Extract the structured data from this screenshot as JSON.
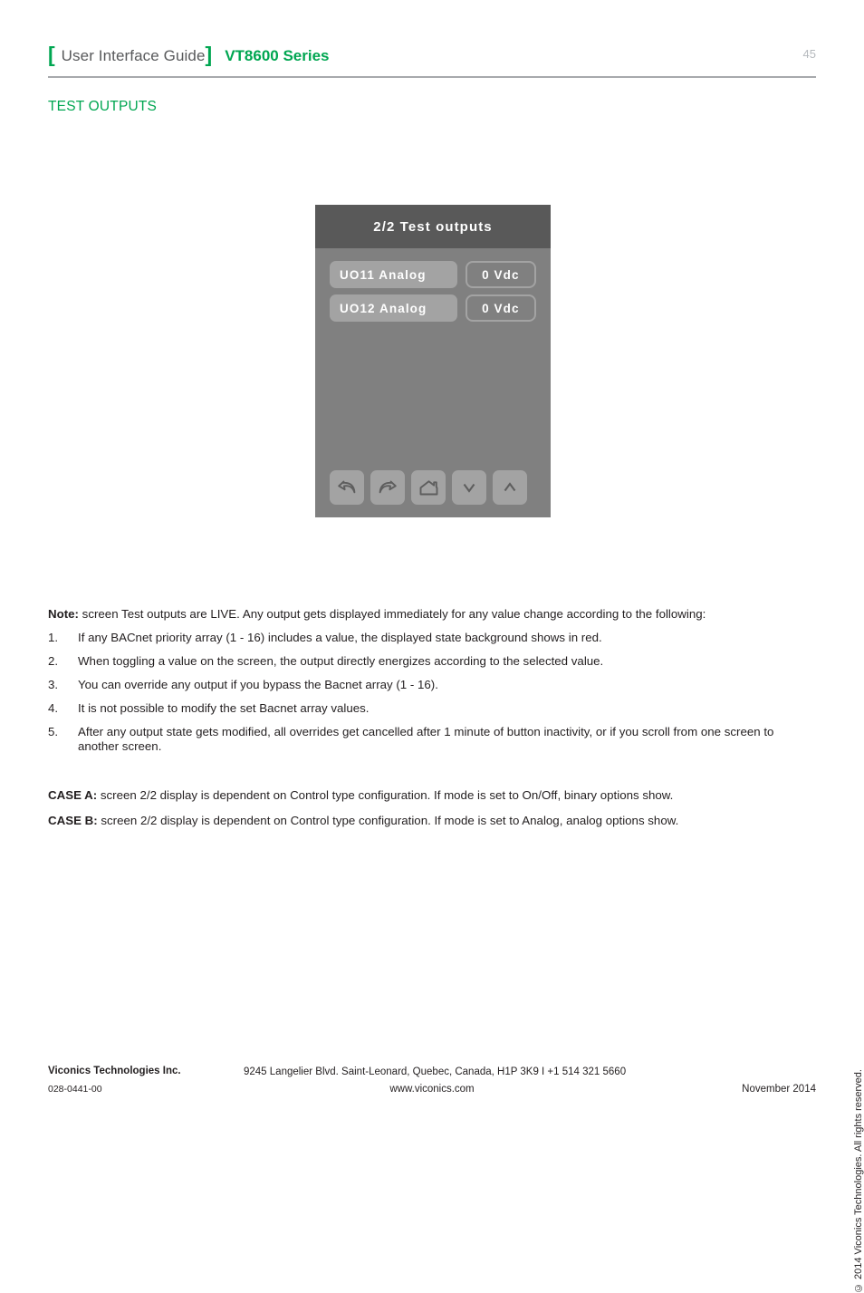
{
  "header": {
    "bracket_left": "[",
    "bracket_right": "]",
    "guide_label": "User Interface Guide",
    "series_label": "VT8600 Series",
    "page_number": "45"
  },
  "section": {
    "title": "TEST OUTPUTS"
  },
  "device": {
    "screen_title": "2/2 Test outputs",
    "rows": [
      {
        "label": "UO11 Analog",
        "value": "0 Vdc"
      },
      {
        "label": "UO12 Analog",
        "value": "0 Vdc"
      }
    ],
    "nav": [
      {
        "name": "undo",
        "glyph": "undo-arrow-icon"
      },
      {
        "name": "redo",
        "glyph": "redo-arrow-icon"
      },
      {
        "name": "home",
        "glyph": "home-icon"
      },
      {
        "name": "down",
        "glyph": "chevron-down-icon"
      },
      {
        "name": "up",
        "glyph": "chevron-up-icon"
      }
    ],
    "colors": {
      "header_bg": "#595959",
      "body_bg": "#808080",
      "pill_bg": "#a3a3a3",
      "text": "#ffffff"
    }
  },
  "notes": {
    "lead_bold": "Note:",
    "lead_text": " screen Test outputs are LIVE. Any output gets displayed immediately for any value change according to the following:",
    "items": [
      {
        "num": "1.",
        "text": "If any BACnet priority array (1 - 16) includes a value, the displayed state background shows in red."
      },
      {
        "num": "2.",
        "text": "When toggling a value on the screen, the output directly energizes according to the selected value."
      },
      {
        "num": "3.",
        "text": "You can override any output if you bypass the Bacnet array (1 - 16)."
      },
      {
        "num": "4.",
        "text": "It is not possible to modify the set Bacnet array values."
      },
      {
        "num": "5.",
        "text": "After any output state gets modified, all overrides get cancelled after 1 minute of button inactivity, or if you scroll from one screen to another screen."
      }
    ]
  },
  "cases": [
    {
      "label": "CASE A:",
      "text": " screen 2/2 display is dependent on Control type configuration. If mode is set to On/Off, binary options show."
    },
    {
      "label": "CASE B:",
      "text": " screen 2/2 display is dependent on Control type configuration. If mode is set to Analog, analog options show."
    }
  ],
  "copyright_vertical": "© 2014 Viconics Technologies. All rights reserved.",
  "footer": {
    "company": "Viconics Technologies Inc.",
    "address": "9245 Langelier Blvd. Saint-Leonard, Quebec, Canada, H1P 3K9   I  +1 514 321 5660",
    "part_number": "028-0441-00",
    "website": "www.viconics.com",
    "date": "November 2014"
  },
  "accent_colors": {
    "green": "#00a651",
    "gray_rule": "#a7a9ac",
    "page_number_gray": "#b5b9bd"
  }
}
